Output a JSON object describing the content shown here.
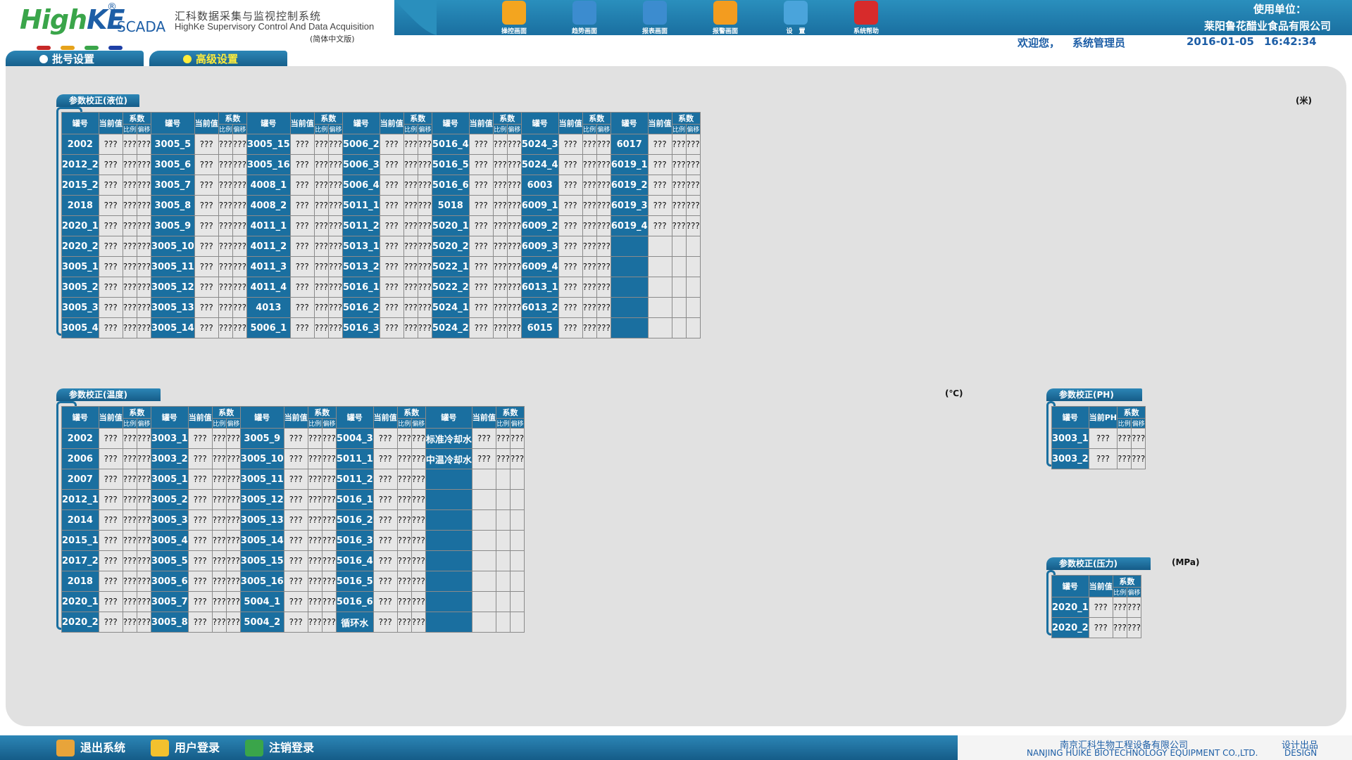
{
  "header": {
    "logo": {
      "brand_high": "High",
      "brand_ke": "KE",
      "registered": "®",
      "scada": "SCADA",
      "title_cn": "汇科数据采集与监视控制系统",
      "title_en": "HighKe Supervisory Control And Data Acquisition",
      "version": "(简体中文版)"
    },
    "toolbar": [
      {
        "label": "操控画面",
        "icon": "hand-control-icon",
        "color": "#f3a51f"
      },
      {
        "label": "趋势画面",
        "icon": "magnifier-trend-icon",
        "color": "#3c8ccf"
      },
      {
        "label": "报表画面",
        "icon": "report-icon",
        "color": "#3c8ccf"
      },
      {
        "label": "报警画面",
        "icon": "alarm-bell-icon",
        "color": "#f39c1f"
      },
      {
        "label": "设　置",
        "icon": "settings-tools-icon",
        "color": "#4aa4db"
      },
      {
        "label": "系统帮助",
        "icon": "help-icon",
        "color": "#d72b2b"
      }
    ],
    "unit_label": "使用单位：",
    "unit_name": "莱阳鲁花醋业食品有限公司",
    "welcome": "欢迎您，",
    "user": "系统管理员",
    "date": "2016-01-05",
    "time": "16:42:34"
  },
  "tabs": [
    {
      "label": "批号设置",
      "dot": "#ffffff",
      "active": false
    },
    {
      "label": "高级设置",
      "dot": "#ffec3a",
      "active": true
    }
  ],
  "headers": {
    "tank": "罐号",
    "current": "当前值",
    "current_ph": "当前PH",
    "coef": "系数",
    "ratio": "比例",
    "offset": "偏移"
  },
  "placeholder": "???",
  "level": {
    "title": "参数校正(液位)",
    "unit": "(米)",
    "groups": [
      [
        "2002",
        "2012_2",
        "2015_2",
        "2018",
        "2020_1",
        "2020_2",
        "3005_1",
        "3005_2",
        "3005_3",
        "3005_4"
      ],
      [
        "3005_5",
        "3005_6",
        "3005_7",
        "3005_8",
        "3005_9",
        "3005_10",
        "3005_11",
        "3005_12",
        "3005_13",
        "3005_14"
      ],
      [
        "3005_15",
        "3005_16",
        "4008_1",
        "4008_2",
        "4011_1",
        "4011_2",
        "4011_3",
        "4011_4",
        "4013",
        "5006_1"
      ],
      [
        "5006_2",
        "5006_3",
        "5006_4",
        "5011_1",
        "5011_2",
        "5013_1",
        "5013_2",
        "5016_1",
        "5016_2",
        "5016_3"
      ],
      [
        "5016_4",
        "5016_5",
        "5016_6",
        "5018",
        "5020_1",
        "5020_2",
        "5022_1",
        "5022_2",
        "5024_1",
        "5024_2"
      ],
      [
        "5024_3",
        "5024_4",
        "6003",
        "6009_1",
        "6009_2",
        "6009_3",
        "6009_4",
        "6013_1",
        "6013_2",
        "6015"
      ],
      [
        "6017",
        "6019_1",
        "6019_2",
        "6019_3",
        "6019_4",
        "",
        "",
        "",
        "",
        ""
      ]
    ]
  },
  "temperature": {
    "title": "参数校正(温度)",
    "unit": "(℃)",
    "groups": [
      [
        "2002",
        "2006",
        "2007",
        "2012_1",
        "2014",
        "2015_1",
        "2017_2",
        "2018",
        "2020_1",
        "2020_2"
      ],
      [
        "3003_1",
        "3003_2",
        "3005_1",
        "3005_2",
        "3005_3",
        "3005_4",
        "3005_5",
        "3005_6",
        "3005_7",
        "3005_8"
      ],
      [
        "3005_9",
        "3005_10",
        "3005_11",
        "3005_12",
        "3005_13",
        "3005_14",
        "3005_15",
        "3005_16",
        "5004_1",
        "5004_2"
      ],
      [
        "5004_3",
        "5011_1",
        "5011_2",
        "5016_1",
        "5016_2",
        "5016_3",
        "5016_4",
        "5016_5",
        "5016_6",
        "循环水"
      ],
      [
        "标准冷却水",
        "中温冷却水",
        "",
        "",
        "",
        "",
        "",
        "",
        "",
        ""
      ]
    ]
  },
  "ph": {
    "title": "参数校正(PH)",
    "groups": [
      [
        "3003_1",
        "3003_2"
      ]
    ]
  },
  "pressure": {
    "title": "参数校正(压力)",
    "unit": "(MPa)",
    "groups": [
      [
        "2020_1",
        "2020_2"
      ]
    ]
  },
  "footer": {
    "exit": "退出系统",
    "login": "用户登录",
    "logout": "注销登录",
    "company_cn": "南京汇科生物工程设备有限公司",
    "company_en": "NANJING HUIKE BIOTECHNOLOGY EQUIPMENT CO.,LTD.",
    "design_cn": "设计出品",
    "design_en": "DESIGN"
  }
}
